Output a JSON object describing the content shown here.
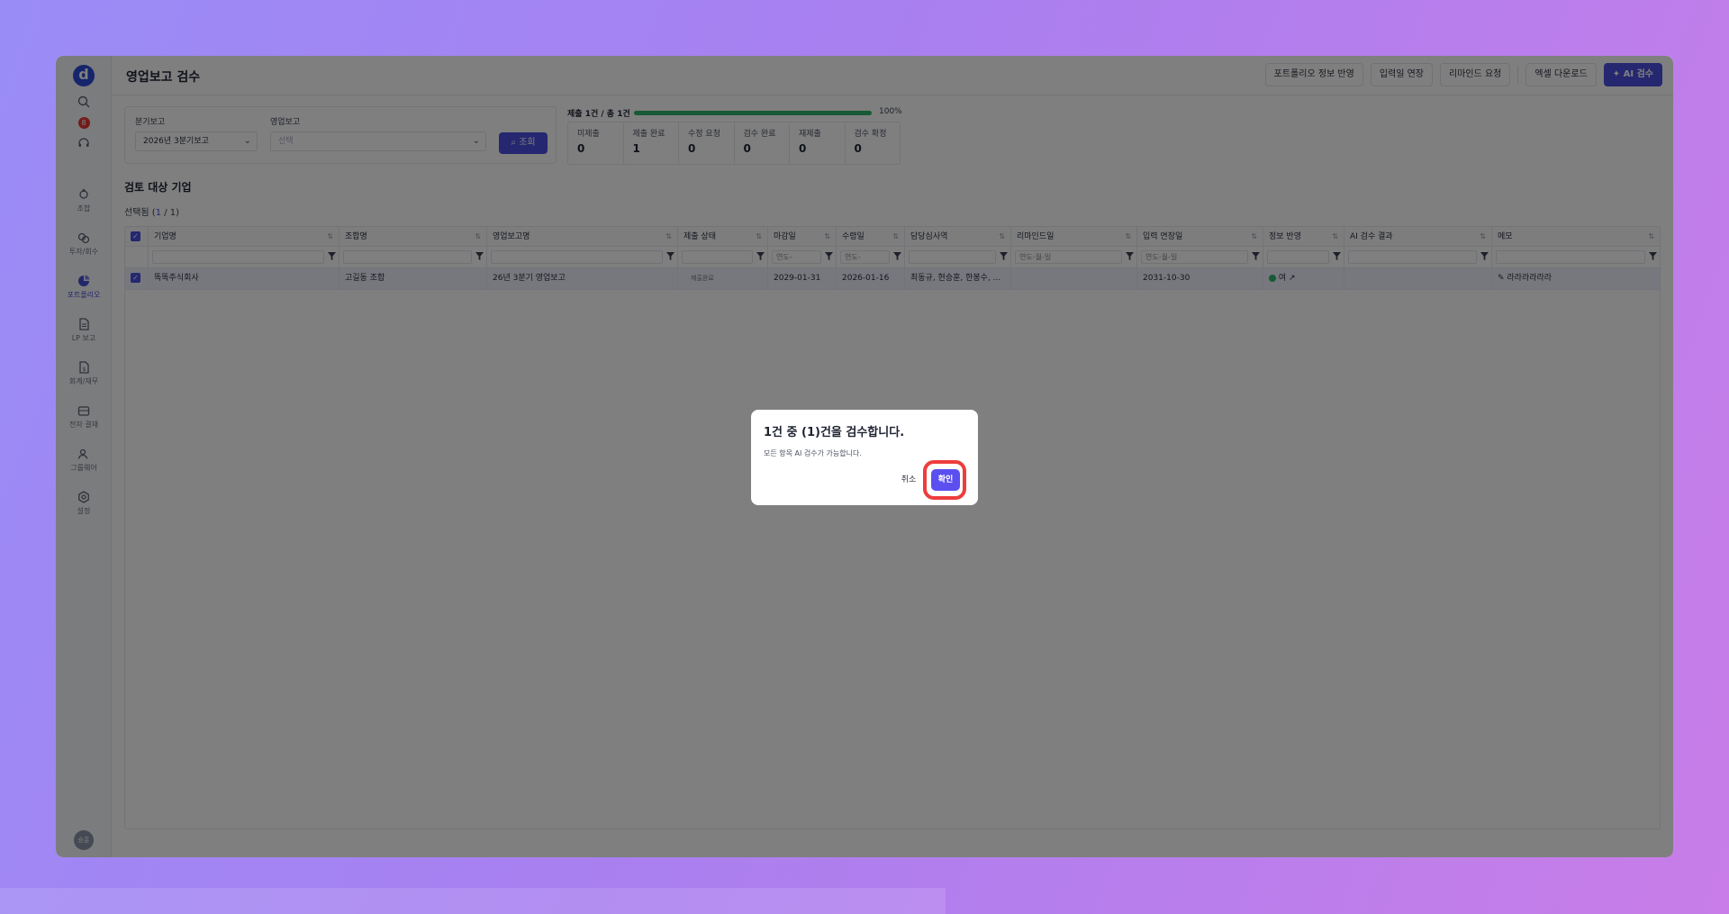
{
  "header": {
    "title": "영업보고 검수",
    "buttons": [
      "포트폴리오 정보 반영",
      "입력일 연장",
      "리마인드 요청",
      "엑셀 다운로드",
      "AI 검수"
    ]
  },
  "sidebar": {
    "logo": "d",
    "badge": "8",
    "items": [
      {
        "label": "조합",
        "icon": "fund-icon"
      },
      {
        "label": "투자/회수",
        "icon": "invest-icon"
      },
      {
        "label": "포트폴리오",
        "icon": "portfolio-icon",
        "active": true
      },
      {
        "label": "LP 보고",
        "icon": "document-icon"
      },
      {
        "label": "회계/재무",
        "icon": "accounting-icon"
      },
      {
        "label": "전자 결재",
        "icon": "approval-icon"
      },
      {
        "label": "그룹웨어",
        "icon": "groupware-icon"
      },
      {
        "label": "설정",
        "icon": "settings-icon"
      }
    ],
    "avatar": "승훈"
  },
  "filters": {
    "quarterly_label": "분기보고",
    "quarterly_value": "2026년 3분기보고",
    "business_label": "영업보고",
    "business_placeholder": "선택",
    "search_label": "조회"
  },
  "progress": {
    "label": "제출 1건 / 총 1건",
    "percent_text": "100%",
    "fraction": 1.0,
    "color": "#2fb56b"
  },
  "stats": [
    {
      "label": "미제출",
      "value": "0"
    },
    {
      "label": "제출 완료",
      "value": "1"
    },
    {
      "label": "수정 요청",
      "value": "0"
    },
    {
      "label": "검수 완료",
      "value": "0"
    },
    {
      "label": "재제출",
      "value": "0"
    },
    {
      "label": "검수 확정",
      "value": "0"
    }
  ],
  "section": {
    "title": "검토 대상 기업",
    "selected_prefix": "선택됨 (",
    "selected_num": "1",
    "selected_sep": " / ",
    "selected_total": "1",
    "selected_suffix": ")"
  },
  "table": {
    "columns": [
      "기업명",
      "조합명",
      "영업보고명",
      "제출 상태",
      "마감일",
      "수령일",
      "담당심사역",
      "리마인드일",
      "입력 연장일",
      "정보 반영",
      "AI 검수 결과",
      "메모"
    ],
    "filter_placeholders": [
      "",
      "",
      "",
      "",
      "연도-",
      "연도-",
      "",
      "연도-월-일",
      "연도-월-일",
      "",
      "",
      ""
    ],
    "rows": [
      {
        "company": "똑똑주식회사",
        "fund": "고길동 조합",
        "report": "26년 3분기 영업보고",
        "status": "제출완료",
        "due": "2029-01-31",
        "received": "2026-01-16",
        "manager": "최동규, 현승훈, 한봉수, ...",
        "remind": "",
        "extended": "2031-10-30",
        "applied": "여",
        "ai_result": "",
        "memo": "라라라라라라"
      }
    ]
  },
  "dialog": {
    "title": "1건 중 (1)건을 검수합니다.",
    "message": "모든 항목 AI 검수가 가능합니다.",
    "cancel": "취소",
    "confirm": "확인",
    "highlight_color": "#ee3d3d"
  }
}
